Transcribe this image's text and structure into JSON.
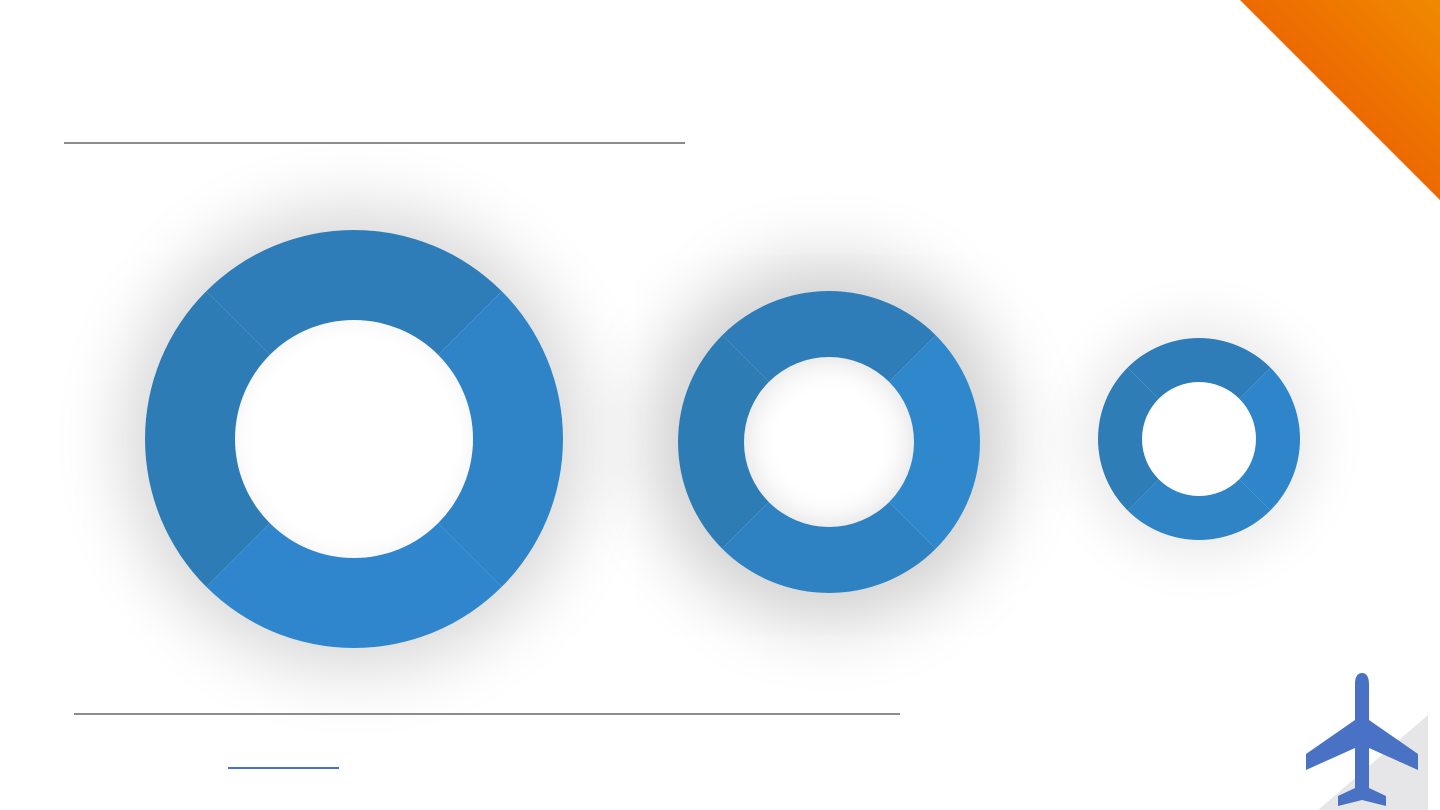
{
  "slide": {
    "accent_color": "#ec6a00",
    "ring_color": "#2f81c4",
    "plane_color": "#4a72c4",
    "rule_color": "#8c8c8c"
  },
  "decor": {
    "corner": "orange-triangle",
    "icons": [
      "ring-large",
      "ring-medium",
      "ring-small",
      "airplane-icon"
    ]
  }
}
